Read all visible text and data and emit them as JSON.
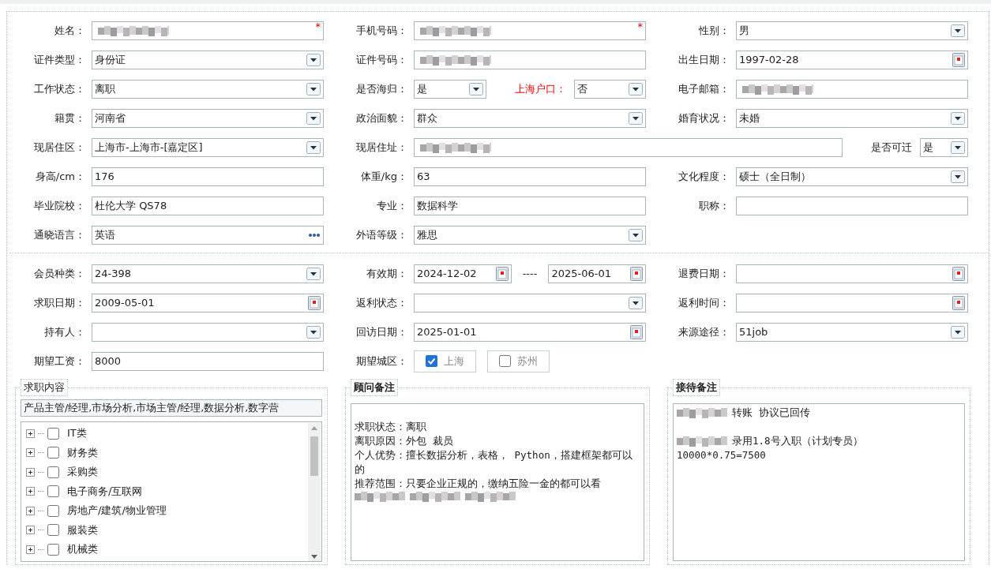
{
  "sections": [
    {
      "rows": [
        {
          "groups": [
            {
              "label": "姓名：",
              "controls": [
                {
                  "kind": "text",
                  "redacted": true,
                  "required_mark": "*"
                }
              ]
            },
            {
              "label": "手机号码：",
              "controls": [
                {
                  "kind": "text",
                  "redacted": true,
                  "required_mark": "*"
                }
              ]
            },
            {
              "label": "性别：",
              "controls": [
                {
                  "kind": "select",
                  "value": "男"
                }
              ]
            }
          ]
        },
        {
          "groups": [
            {
              "label": "证件类型：",
              "controls": [
                {
                  "kind": "select",
                  "value": "身份证"
                }
              ]
            },
            {
              "label": "证件号码：",
              "controls": [
                {
                  "kind": "text",
                  "redacted": true
                }
              ]
            },
            {
              "label": "出生日期：",
              "controls": [
                {
                  "kind": "date",
                  "value": "1997-02-28"
                }
              ]
            }
          ]
        },
        {
          "groups": [
            {
              "label": "工作状态：",
              "controls": [
                {
                  "kind": "select",
                  "value": "离职"
                }
              ]
            },
            {
              "label": "是否海归：",
              "controls": [
                {
                  "kind": "select",
                  "value": "是"
                },
                {
                  "kind": "label",
                  "text": "上海户口：",
                  "highlighted": true
                },
                {
                  "kind": "select",
                  "value": "否"
                }
              ]
            },
            {
              "label": "电子邮箱：",
              "controls": [
                {
                  "kind": "text",
                  "redacted": true
                }
              ]
            }
          ]
        },
        {
          "groups": [
            {
              "label": "籍贯：",
              "controls": [
                {
                  "kind": "select",
                  "value": "河南省"
                }
              ]
            },
            {
              "label": "政治面貌：",
              "controls": [
                {
                  "kind": "select",
                  "value": "群众"
                }
              ]
            },
            {
              "label": "婚育状况：",
              "controls": [
                {
                  "kind": "select",
                  "value": "未婚"
                }
              ]
            }
          ]
        },
        {
          "groups": [
            {
              "label": "现居住区：",
              "controls": [
                {
                  "kind": "select",
                  "value": "上海市-上海市-[嘉定区]"
                }
              ]
            },
            {
              "label": "现居住址：",
              "controls": [
                {
                  "kind": "text",
                  "redacted": true
                },
                {
                  "kind": "label",
                  "text": "是否可迁",
                  "highlighted": false
                },
                {
                  "kind": "select",
                  "value": "是"
                }
              ]
            }
          ]
        },
        {
          "groups": [
            {
              "label": "身高/cm：",
              "controls": [
                {
                  "kind": "text",
                  "value": "176"
                }
              ]
            },
            {
              "label": "体重/kg：",
              "controls": [
                {
                  "kind": "text",
                  "value": "63"
                }
              ]
            },
            {
              "label": "文化程度：",
              "controls": [
                {
                  "kind": "select",
                  "value": "硕士（全日制）"
                }
              ]
            }
          ]
        },
        {
          "groups": [
            {
              "label": "毕业院校：",
              "controls": [
                {
                  "kind": "text",
                  "value": "杜伦大学 QS78"
                }
              ]
            },
            {
              "label": "专业：",
              "controls": [
                {
                  "kind": "text",
                  "value": "数据科学"
                }
              ]
            },
            {
              "label": "职称：",
              "controls": [
                {
                  "kind": "text"
                }
              ]
            }
          ]
        },
        {
          "groups": [
            {
              "label": "通晓语言：",
              "controls": [
                {
                  "kind": "picker",
                  "value": "英语"
                }
              ]
            },
            {
              "label": "外语等级：",
              "controls": [
                {
                  "kind": "select",
                  "value": "雅思"
                }
              ]
            }
          ]
        }
      ]
    },
    {
      "rows": [
        {
          "groups": [
            {
              "label": "会员种类：",
              "controls": [
                {
                  "kind": "select",
                  "value": "24-398"
                }
              ]
            },
            {
              "label": "有效期：",
              "controls": [
                {
                  "kind": "date",
                  "value": "2024-12-02"
                },
                {
                  "kind": "separator",
                  "text": "----"
                },
                {
                  "kind": "date",
                  "value": "2025-06-01"
                }
              ]
            },
            {
              "label": "退费日期：",
              "controls": [
                {
                  "kind": "date"
                }
              ]
            }
          ]
        },
        {
          "groups": [
            {
              "label": "求职日期：",
              "controls": [
                {
                  "kind": "date",
                  "value": "2009-05-01"
                }
              ]
            },
            {
              "label": "返利状态：",
              "controls": [
                {
                  "kind": "select"
                }
              ]
            },
            {
              "label": "返利时间：",
              "controls": [
                {
                  "kind": "date"
                }
              ]
            }
          ]
        },
        {
          "groups": [
            {
              "label": "持有人：",
              "controls": [
                {
                  "kind": "select"
                }
              ]
            },
            {
              "label": "回访日期：",
              "controls": [
                {
                  "kind": "date",
                  "value": "2025-01-01"
                }
              ]
            },
            {
              "label": "来源途径：",
              "controls": [
                {
                  "kind": "select",
                  "value": "51job"
                }
              ]
            }
          ]
        },
        {
          "groups": [
            {
              "label": "期望工资：",
              "controls": [
                {
                  "kind": "text",
                  "value": "8000"
                }
              ]
            },
            {
              "label": "期望城区：",
              "controls": [
                {
                  "kind": "checkbox",
                  "text": "上海",
                  "checked": true
                },
                {
                  "kind": "checkbox",
                  "text": "苏州",
                  "checked": false
                }
              ]
            }
          ]
        }
      ]
    }
  ],
  "panels": [
    {
      "title": "求职内容",
      "emphasis": false,
      "kind": "tree",
      "selection": "产品主管/经理,市场分析,市场主管/经理,数据分析,数字营",
      "items": [
        {
          "label": "IT类",
          "expanded": false,
          "checked": false
        },
        {
          "label": "财务类",
          "expanded": false,
          "checked": false
        },
        {
          "label": "采购类",
          "expanded": false,
          "checked": false
        },
        {
          "label": "电子商务/互联网",
          "expanded": false,
          "checked": false
        },
        {
          "label": "房地产/建筑/物业管理",
          "expanded": false,
          "checked": false
        },
        {
          "label": "服装类",
          "expanded": false,
          "checked": false
        },
        {
          "label": "机械类",
          "expanded": false,
          "checked": false
        }
      ]
    },
    {
      "title": "顾问备注",
      "emphasis": true,
      "kind": "notes",
      "lines": [
        {
          "kind": "blank"
        },
        {
          "kind": "text",
          "segments": [
            {
              "kind": "text",
              "text": "求职状态：离职"
            }
          ]
        },
        {
          "kind": "text",
          "segments": [
            {
              "kind": "text",
              "text": "离职原因：外包 裁员"
            }
          ]
        },
        {
          "kind": "text",
          "segments": [
            {
              "kind": "text",
              "text": "个人优势：擅长数据分析，表格， Python，搭建框架都可以的"
            }
          ]
        },
        {
          "kind": "text",
          "segments": [
            {
              "kind": "text",
              "text": "推荐范围：只要企业正规的，缴纳五险一金的都可以看"
            }
          ]
        },
        {
          "kind": "text",
          "segments": [
            {
              "kind": "redacted"
            },
            {
              "kind": "redacted"
            },
            {
              "kind": "redacted"
            }
          ]
        }
      ]
    },
    {
      "title": "接待备注",
      "emphasis": true,
      "kind": "notes",
      "lines": [
        {
          "kind": "text",
          "segments": [
            {
              "kind": "redacted"
            },
            {
              "kind": "text",
              "text": "转账 协议已回传"
            }
          ]
        },
        {
          "kind": "blank"
        },
        {
          "kind": "text",
          "segments": [
            {
              "kind": "redacted"
            },
            {
              "kind": "text",
              "text": "录用1.8号入职（计划专员）"
            }
          ]
        },
        {
          "kind": "text",
          "segments": [
            {
              "kind": "text",
              "text": "10000*0.75=7500"
            }
          ]
        }
      ]
    }
  ]
}
